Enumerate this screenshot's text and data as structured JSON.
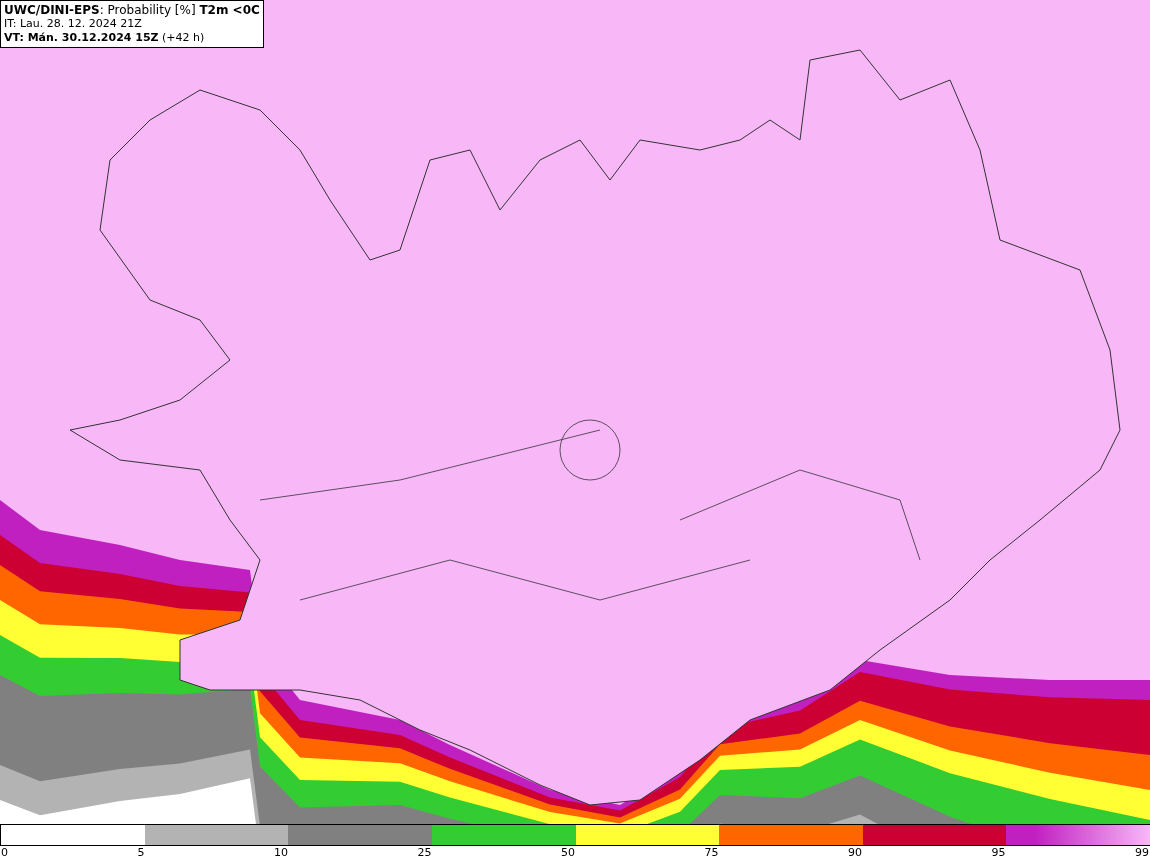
{
  "header": {
    "title": "**UWC/DINI-EPS**: Probability [%] **T2m <0C**",
    "init_time": "IT: Lau. 28. 12. 2024 21Z",
    "valid_time": "**VT: Mán. 30.12.2024 15Z** (+42 h)"
  },
  "legend": {
    "segments": [
      {
        "color": "#ffffff"
      },
      {
        "color": "#b3b3b3"
      },
      {
        "color": "#808080"
      },
      {
        "color": "#33cc33"
      },
      {
        "color": "#ffff33"
      },
      {
        "color": "#ff6600"
      },
      {
        "color": "#cc0033"
      },
      {
        "color": "#c020c0"
      }
    ],
    "ticks": [
      "0",
      "5",
      "10",
      "25",
      "50",
      "75",
      "90",
      "95",
      "99"
    ]
  }
}
